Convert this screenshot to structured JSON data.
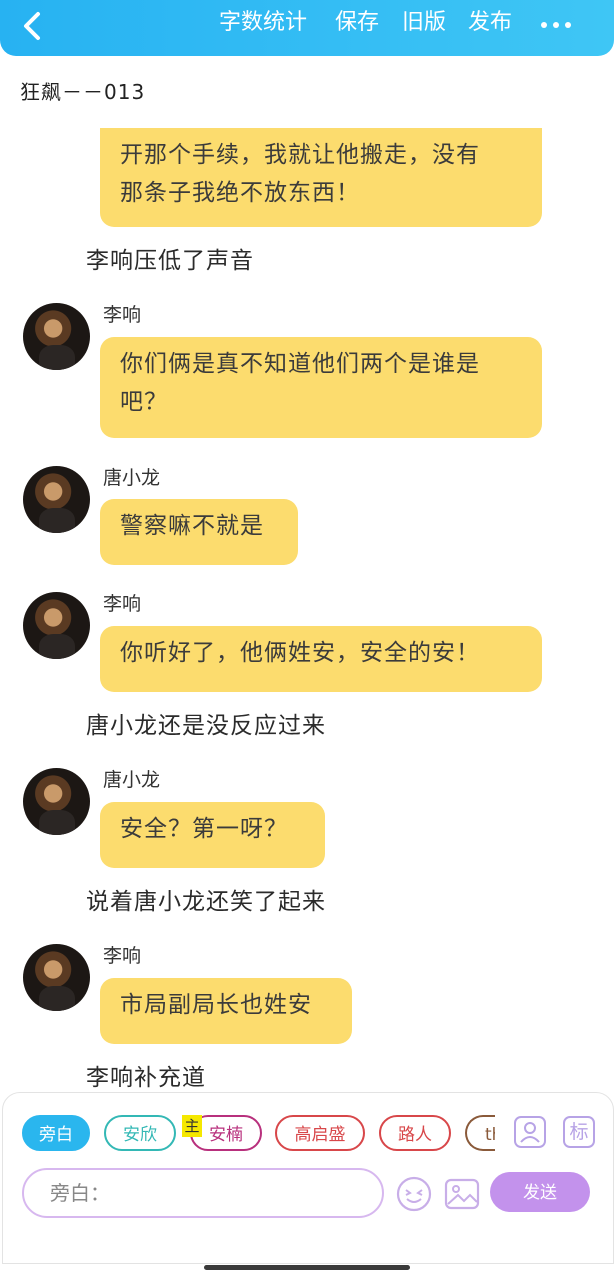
{
  "header": {
    "back_icon": "chevron-left-icon",
    "actions": [
      "字数统计",
      "保存",
      "旧版",
      "发布"
    ],
    "more_icon": "more-dots-icon",
    "accent": "#2fbcf3"
  },
  "chapter_title": "狂飙－－013",
  "messages": [
    {
      "kind": "bubble",
      "text_lines": [
        "开那个手续，我就让他搬走，没有",
        "那条子我绝不放东西！"
      ]
    },
    {
      "kind": "narration",
      "text": "李响压低了声音"
    },
    {
      "kind": "chat",
      "speaker": "李响",
      "text_lines": [
        "你们俩是真不知道他们两个是谁是",
        "吧？"
      ]
    },
    {
      "kind": "chat",
      "speaker": "唐小龙",
      "text_lines": [
        "警察嘛不就是"
      ]
    },
    {
      "kind": "chat",
      "speaker": "李响",
      "text_lines": [
        "你听好了，他俩姓安，安全的安！"
      ]
    },
    {
      "kind": "narration",
      "text": "唐小龙还是没反应过来"
    },
    {
      "kind": "chat",
      "speaker": "唐小龙",
      "text_lines": [
        "安全？第一呀？"
      ]
    },
    {
      "kind": "narration",
      "text": "说着唐小龙还笑了起来"
    },
    {
      "kind": "chat",
      "speaker": "李响",
      "text_lines": [
        "市局副局长也姓安"
      ]
    },
    {
      "kind": "narration",
      "text": "李响补充道"
    }
  ],
  "bubble_color": "#fcdc6e",
  "roles": [
    {
      "label": "旁白",
      "selected": true,
      "color": "#2ab6ee"
    },
    {
      "label": "安欣",
      "color": "#33b8b5"
    },
    {
      "label": "安楠",
      "color": "#b8307d",
      "badge": "主"
    },
    {
      "label": "高启盛",
      "color": "#d8474a"
    },
    {
      "label": "路人",
      "color": "#d8474a"
    },
    {
      "label": "th",
      "color": "#8a5a3a"
    }
  ],
  "tool_icons": [
    "user-card-icon",
    "label-tag-icon"
  ],
  "tag_label": "标",
  "input": {
    "placeholder": "旁白：",
    "value": ""
  },
  "emoji_icon": "emoji-icon",
  "image_icon": "image-icon",
  "send_label": "发送",
  "send_color": "#c392ec"
}
